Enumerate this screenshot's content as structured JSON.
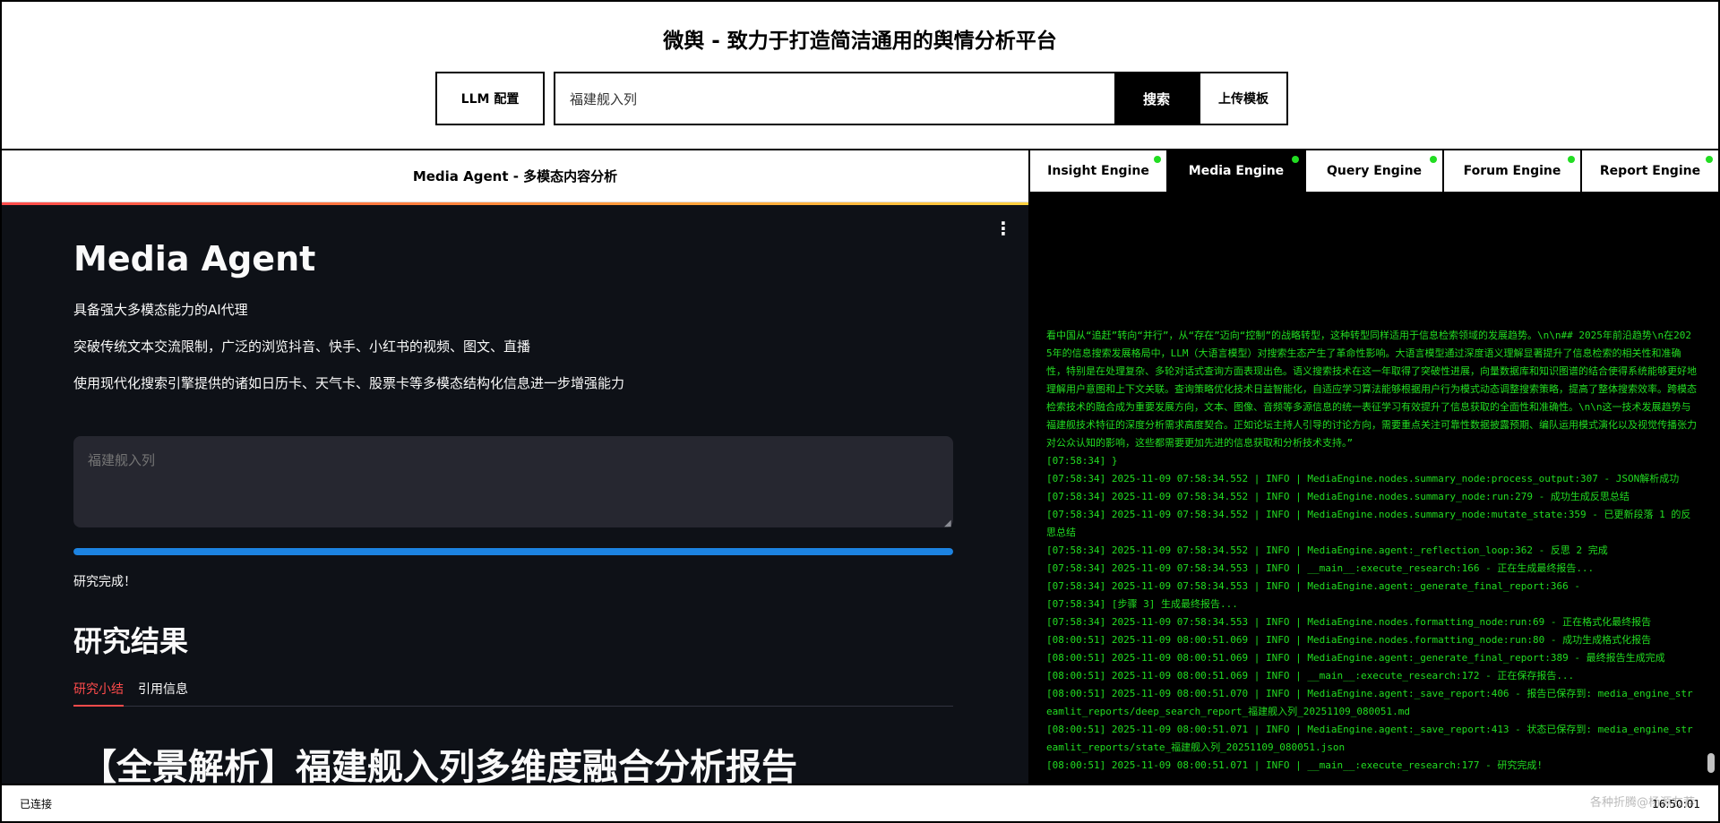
{
  "header": {
    "title": "微舆 - 致力于打造简洁通用的舆情分析平台",
    "llm_config_label": "LLM 配置",
    "search_value": "福建舰入列",
    "search_label": "搜索",
    "upload_label": "上传模板"
  },
  "left": {
    "header_title": "Media Agent - 多模态内容分析",
    "agent_title": "Media Agent",
    "line1": "具备强大多模态能力的AI代理",
    "line2": "突破传统文本交流限制，广泛的浏览抖音、快手、小红书的视频、图文、直播",
    "line3": "使用现代化搜索引擎提供的诸如日历卡、天气卡、股票卡等多模态结构化信息进一步增强能力",
    "query_placeholder": "福建舰入列",
    "progress": 1.0,
    "done_text": "研究完成！",
    "results_title": "研究结果",
    "tabs": [
      "研究小结",
      "引用信息"
    ],
    "report_title": "【全景解析】福建舰入列多维度融合分析报告"
  },
  "engines": {
    "tabs": [
      "Insight Engine",
      "Media Engine",
      "Query Engine",
      "Forum Engine",
      "Report Engine"
    ],
    "active": "Media Engine"
  },
  "log": [
    "看中国从“追赶”转向“并行”，从“存在”迈向“控制”的战略转型，这种转型同样适用于信息检索领域的发展趋势。\\n\\n## 2025年前沿趋势\\n在2025年的信息搜索发展格局中，LLM（大语言模型）对搜索生态产生了革命性影响。大语言模型通过深度语义理解显著提升了信息检索的相关性和准确性，特别是在处理复杂、多轮对话式查询方面表现出色。语义搜索技术在这一年取得了突破性进展，向量数据库和知识图谱的结合使得系统能够更好地理解用户意图和上下文关联。查询策略优化技术日益智能化，自适应学习算法能够根据用户行为模式动态调整搜索策略，提高了整体搜索效率。跨模态检索技术的融合成为重要发展方向，文本、图像、音频等多源信息的统一表征学习有效提升了信息获取的全面性和准确性。\\n\\n这一技术发展趋势与福建舰技术特征的深度分析需求高度契合。正如论坛主持人引导的讨论方向，需要重点关注可靠性数据披露预期、编队运用模式演化以及视觉传播张力对公众认知的影响，这些都需要更加先进的信息获取和分析技术支持。”",
    "[07:58:34] }",
    "[07:58:34] 2025-11-09 07:58:34.552 | INFO     | MediaEngine.nodes.summary_node:process_output:307 - JSON解析成功",
    "[07:58:34] 2025-11-09 07:58:34.552 | INFO     | MediaEngine.nodes.summary_node:run:279 - 成功生成反思总结",
    "[07:58:34] 2025-11-09 07:58:34.552 | INFO     | MediaEngine.nodes.summary_node:mutate_state:359 - 已更新段落 1 的反思总结",
    "[07:58:34] 2025-11-09 07:58:34.552 | INFO     | MediaEngine.agent:_reflection_loop:362 -     反思 2 完成",
    "[07:58:34] 2025-11-09 07:58:34.553 | INFO     | __main__:execute_research:166 - 正在生成最终报告...",
    "[07:58:34] 2025-11-09 07:58:34.553 | INFO     | MediaEngine.agent:_generate_final_report:366 -",
    "[07:58:34] [步骤 3] 生成最终报告...",
    "[07:58:34] 2025-11-09 07:58:34.553 | INFO     | MediaEngine.nodes.formatting_node:run:69 - 正在格式化最终报告",
    "[08:00:51] 2025-11-09 08:00:51.069 | INFO     | MediaEngine.nodes.formatting_node:run:80 - 成功生成格式化报告",
    "[08:00:51] 2025-11-09 08:00:51.069 | INFO     | MediaEngine.agent:_generate_final_report:389 - 最终报告生成完成",
    "[08:00:51] 2025-11-09 08:00:51.069 | INFO     | __main__:execute_research:172 - 正在保存报告...",
    "[08:00:51] 2025-11-09 08:00:51.070 | INFO     | MediaEngine.agent:_save_report:406 - 报告已保存到: media_engine_streamlit_reports/deep_search_report_福建舰入列_20251109_080051.md",
    "[08:00:51] 2025-11-09 08:00:51.071 | INFO     | MediaEngine.agent:_save_report:413 - 状态已保存到: media_engine_streamlit_reports/state_福建舰入列_20251109_080051.json",
    "[08:00:51] 2025-11-09 08:00:51.071 | INFO     | __main__:execute_research:177 - 研究完成!"
  ],
  "status": {
    "connection": "已连接",
    "time": "16:50:01",
    "watermark": "各种折腾@杨源友荐"
  }
}
